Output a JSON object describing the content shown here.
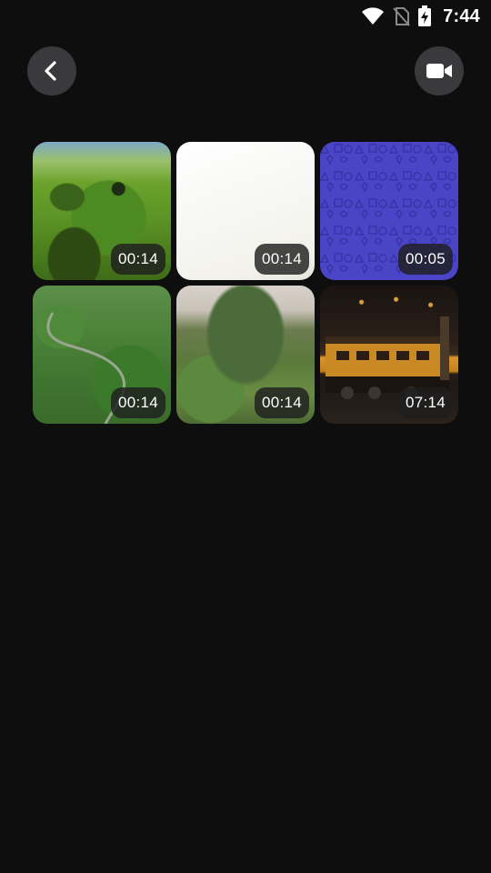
{
  "status_bar": {
    "time": "7:44",
    "icons": [
      "wifi-icon",
      "no-sim-icon",
      "battery-charging-icon"
    ]
  },
  "header": {
    "back_icon": "chevron-left-icon",
    "video_icon": "video-camera-icon"
  },
  "videos": [
    {
      "duration": "00:14",
      "thumbnail": "hobbit-hole-hillside"
    },
    {
      "duration": "00:14",
      "thumbnail": "white-blank"
    },
    {
      "duration": "00:05",
      "thumbnail": "blue-pattern"
    },
    {
      "duration": "00:14",
      "thumbnail": "green-valley-road"
    },
    {
      "duration": "00:14",
      "thumbnail": "terraced-hills"
    },
    {
      "duration": "07:14",
      "thumbnail": "train-at-night"
    }
  ],
  "colors": {
    "background": "#0e0e0f",
    "button_bg": "#3a3a3d",
    "badge_bg": "#1e1e1e",
    "text": "#ffffff",
    "pattern_blue": "#4a45c6"
  }
}
